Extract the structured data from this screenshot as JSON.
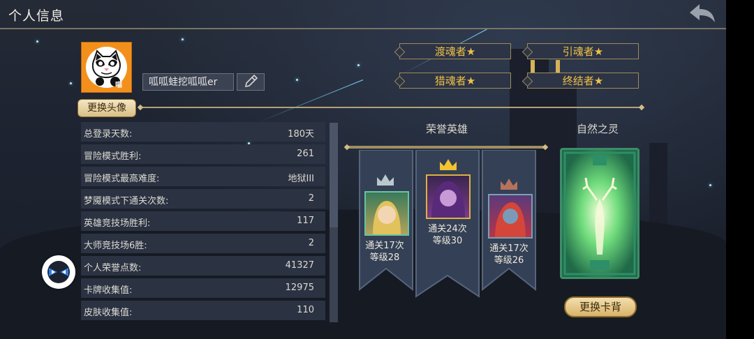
{
  "header": {
    "title": "个人信息",
    "back_icon": "back-arrow-icon"
  },
  "profile": {
    "name": "呱呱蛙挖呱呱er",
    "change_avatar_label": "更换头像",
    "avatar_badge": "喵",
    "edit_icon": "pencil-icon"
  },
  "titles": [
    "渡魂者★",
    "引魂者★",
    "猎魂者★",
    "终结者★"
  ],
  "stats": [
    {
      "label": "总登录天数:",
      "value": "180天"
    },
    {
      "label": "冒险模式胜利:",
      "value": "261"
    },
    {
      "label": "冒险模式最高难度:",
      "value": "地狱III"
    },
    {
      "label": "梦魇模式下通关次数:",
      "value": "2"
    },
    {
      "label": "英雄竞技场胜利:",
      "value": "117"
    },
    {
      "label": "大师竞技场6胜:",
      "value": "2"
    },
    {
      "label": "个人荣誉点数:",
      "value": "41327"
    },
    {
      "label": "卡牌收集值:",
      "value": "12975"
    },
    {
      "label": "皮肤收集值:",
      "value": "110"
    }
  ],
  "honor": {
    "title": "荣誉英雄",
    "heroes": [
      {
        "rank": "silver",
        "clears": "通关17次",
        "level": "等级28"
      },
      {
        "rank": "gold",
        "clears": "通关24次",
        "level": "等级30"
      },
      {
        "rank": "bronze",
        "clears": "通关17次",
        "level": "等级26"
      }
    ]
  },
  "card_back": {
    "title": "自然之灵",
    "change_label": "更换卡背"
  },
  "colors": {
    "title_gold": "#f0c048",
    "avatar_orange": "#f3901c",
    "panel": "#2b3242"
  }
}
